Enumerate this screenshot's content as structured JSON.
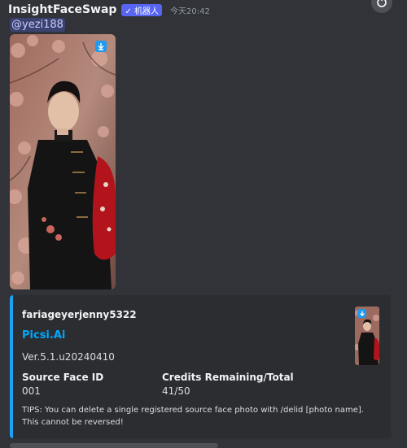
{
  "message": {
    "author": "InsightFaceSwap",
    "bot_badge": "✓ 机器人",
    "timestamp": "今天20:42",
    "mention": "@yezi188"
  },
  "attachment": {
    "icon": "download-icon"
  },
  "embed": {
    "author": "fariageyerjenny5322",
    "title": "Picsi.Ai",
    "description": "Ver.5.1.u20240410",
    "fields": [
      {
        "name": "Source Face ID",
        "value": "001"
      },
      {
        "name": "Credits Remaining/Total",
        "value": "41/50"
      }
    ],
    "tips": "TIPS: You can delete a single registered source face photo with /delid [photo name]. This cannot be reversed!",
    "accent_color": "#1ea0f3",
    "title_color": "#00a8fc"
  }
}
